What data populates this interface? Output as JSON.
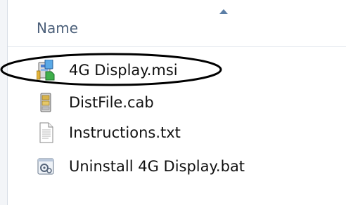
{
  "header": {
    "column_name_label": "Name"
  },
  "files": [
    {
      "name": "4G Display.msi",
      "icon": "msi-installer-icon"
    },
    {
      "name": "DistFile.cab",
      "icon": "cabinet-file-icon"
    },
    {
      "name": "Instructions.txt",
      "icon": "text-document-icon"
    },
    {
      "name": "Uninstall 4G Display.bat",
      "icon": "batch-file-icon"
    }
  ],
  "colors": {
    "header_text": "#4c607a",
    "sort_arrow": "#5b7ea6",
    "ellipse_stroke": "#000000"
  }
}
